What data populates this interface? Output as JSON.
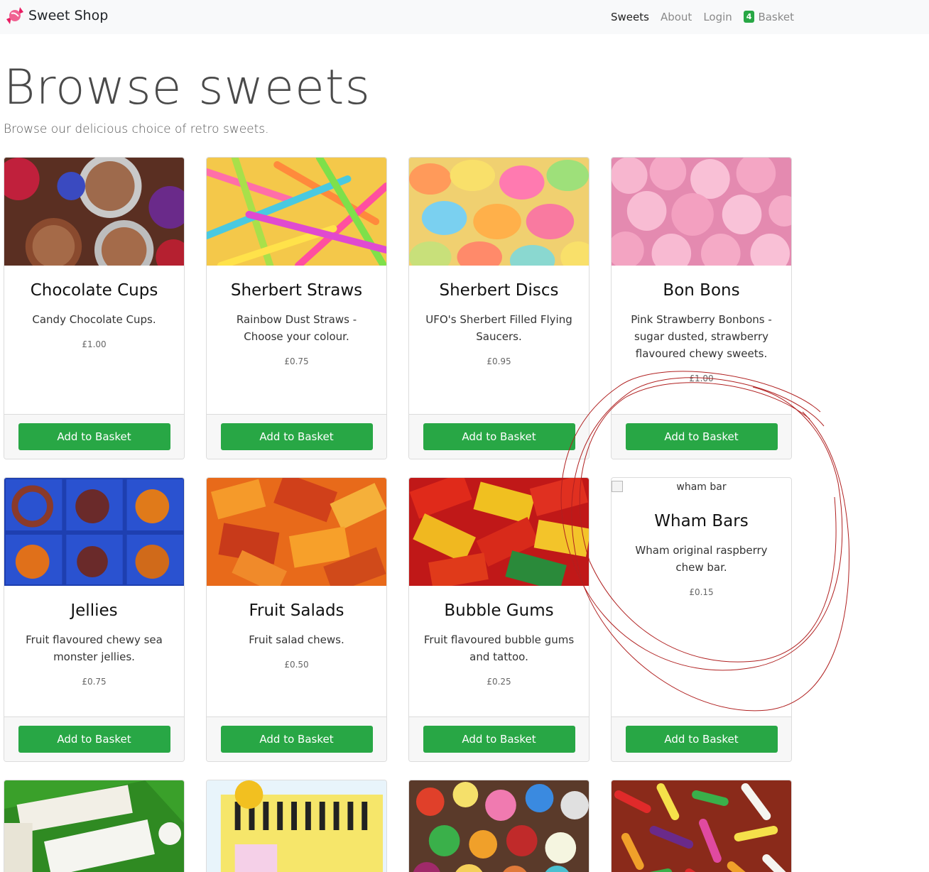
{
  "nav": {
    "brand": "Sweet Shop",
    "links": [
      "Sweets",
      "About",
      "Login"
    ],
    "basket_count": "4",
    "basket_label": "Basket"
  },
  "jumbotron": {
    "title": "Browse sweets",
    "lead": "Browse our delicious choice of retro sweets."
  },
  "products": [
    {
      "name": "Chocolate Cups",
      "desc": "Candy Chocolate Cups.",
      "price": "£1.00",
      "button": "Add to Basket"
    },
    {
      "name": "Sherbert Straws",
      "desc": "Rainbow Dust Straws - Choose your colour.",
      "price": "£0.75",
      "button": "Add to Basket"
    },
    {
      "name": "Sherbert Discs",
      "desc": "UFO's Sherbert Filled Flying Saucers.",
      "price": "£0.95",
      "button": "Add to Basket"
    },
    {
      "name": "Bon Bons",
      "desc": "Pink Strawberry Bonbons - sugar dusted, strawberry flavoured chewy sweets.",
      "price": "£1.00",
      "button": "Add to Basket"
    },
    {
      "name": "Jellies",
      "desc": "Fruit flavoured chewy sea monster jellies.",
      "price": "£0.75",
      "button": "Add to Basket"
    },
    {
      "name": "Fruit Salads",
      "desc": "Fruit salad chews.",
      "price": "£0.50",
      "button": "Add to Basket"
    },
    {
      "name": "Bubble Gums",
      "desc": "Fruit flavoured bubble gums and tattoo.",
      "price": "£0.25",
      "button": "Add to Basket"
    },
    {
      "name": "Wham Bars",
      "desc": "Wham original raspberry chew bar.",
      "price": "£0.15",
      "button": "Add to Basket",
      "img_alt": "wham bar"
    }
  ]
}
